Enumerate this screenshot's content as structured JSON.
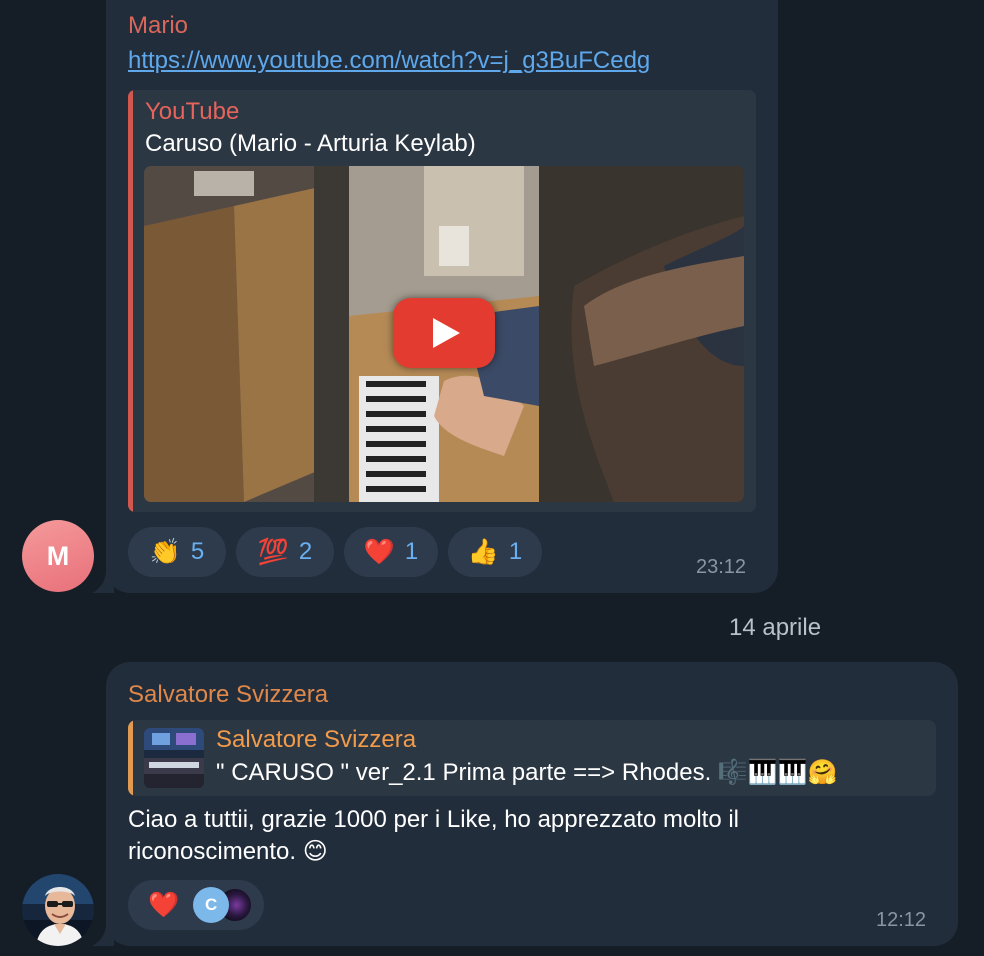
{
  "message1": {
    "sender": "Mario",
    "sender_color": "#d9675b",
    "link": "https://www.youtube.com/watch?v=j_g3BuFCedg",
    "preview": {
      "site": "YouTube",
      "title": "Caruso (Mario - Arturia Keylab)"
    },
    "reactions": [
      {
        "icon": "clapping-hands-icon",
        "emoji": "👏",
        "count": "5"
      },
      {
        "icon": "hundred-points-icon",
        "emoji": "💯",
        "count": "2"
      },
      {
        "icon": "red-heart-icon",
        "emoji": "❤️",
        "count": "1"
      },
      {
        "icon": "thumbs-up-icon",
        "emoji": "👍",
        "count": "1"
      }
    ],
    "time": "23:12",
    "avatar_initial": "M"
  },
  "date_separator": "14 aprile",
  "message2": {
    "sender": "Salvatore Svizzera",
    "sender_color": "#e0884a",
    "reply": {
      "name": "Salvatore Svizzera",
      "text": "\" CARUSO \" ver_2.1 Prima parte ==> Rhodes. 🎼🎹🎹🤗"
    },
    "text": "Ciao a tuttii, grazie 1000  per i Like, ho apprezzato molto il riconoscimento. 😊",
    "reaction": {
      "icon": "red-heart-icon",
      "emoji": "❤️",
      "user_initial": "C"
    },
    "time": "12:12"
  }
}
